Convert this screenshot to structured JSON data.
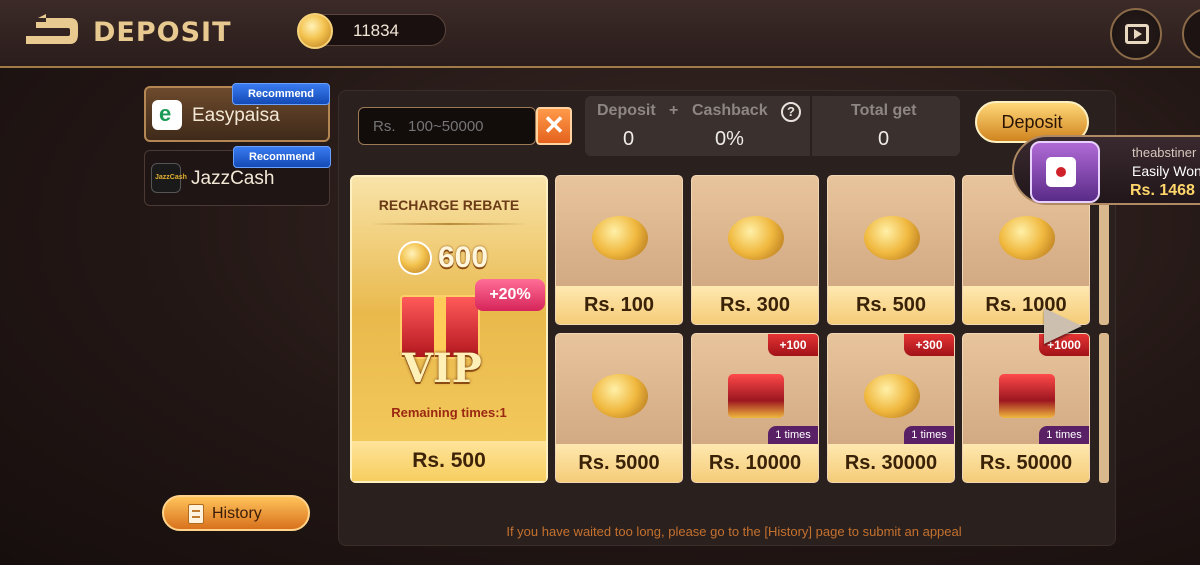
{
  "header": {
    "title": "DEPOSIT",
    "balance": "11834"
  },
  "methods": [
    {
      "label": "Easypaisa",
      "badge": "Recommend",
      "logo_text": ""
    },
    {
      "label": "JazzCash",
      "badge": "Recommend",
      "logo_text": "JazzCash"
    }
  ],
  "history_label": "History",
  "amount_input": {
    "prefix": "Rs.",
    "placeholder": "Rs.   100~50000",
    "clear_symbol": "✕"
  },
  "summary": {
    "deposit_label": "Deposit",
    "plus": "+",
    "cashback_label": "Cashback",
    "help_symbol": "?",
    "total_label": "Total get",
    "deposit_value": "0",
    "cashback_value": "0%",
    "total_value": "0"
  },
  "deposit_button": "Deposit",
  "vip_card": {
    "title": "RECHARGE REBATE",
    "amount": "600",
    "bonus": "+20%",
    "vip_text": "VIP",
    "remaining": "Remaining times:1",
    "price": "Rs. 500"
  },
  "packages": [
    {
      "price": "Rs. 100",
      "tag": "",
      "times": ""
    },
    {
      "price": "Rs. 300",
      "tag": "",
      "times": ""
    },
    {
      "price": "Rs. 500",
      "tag": "",
      "times": ""
    },
    {
      "price": "Rs. 1000",
      "tag": "",
      "times": ""
    },
    {
      "price": "Rs. 5000",
      "tag": "",
      "times": ""
    },
    {
      "price": "Rs. 10000",
      "tag": "+100",
      "times": "1 times"
    },
    {
      "price": "Rs. 30000",
      "tag": "+300",
      "times": "1 times"
    },
    {
      "price": "Rs. 50000",
      "tag": "+1000",
      "times": "1 times"
    }
  ],
  "footer_note": "If you have waited too long, please go to the [History] page to submit an appeal",
  "winner_toast": {
    "name": "theabstiner",
    "message": "Easily Won",
    "amount": "Rs. 1468"
  },
  "colors": {
    "accent_gold": "#e8c98f",
    "badge_blue": "#134ab6",
    "tag_red": "#a11218",
    "note_orange": "#c5712e"
  }
}
